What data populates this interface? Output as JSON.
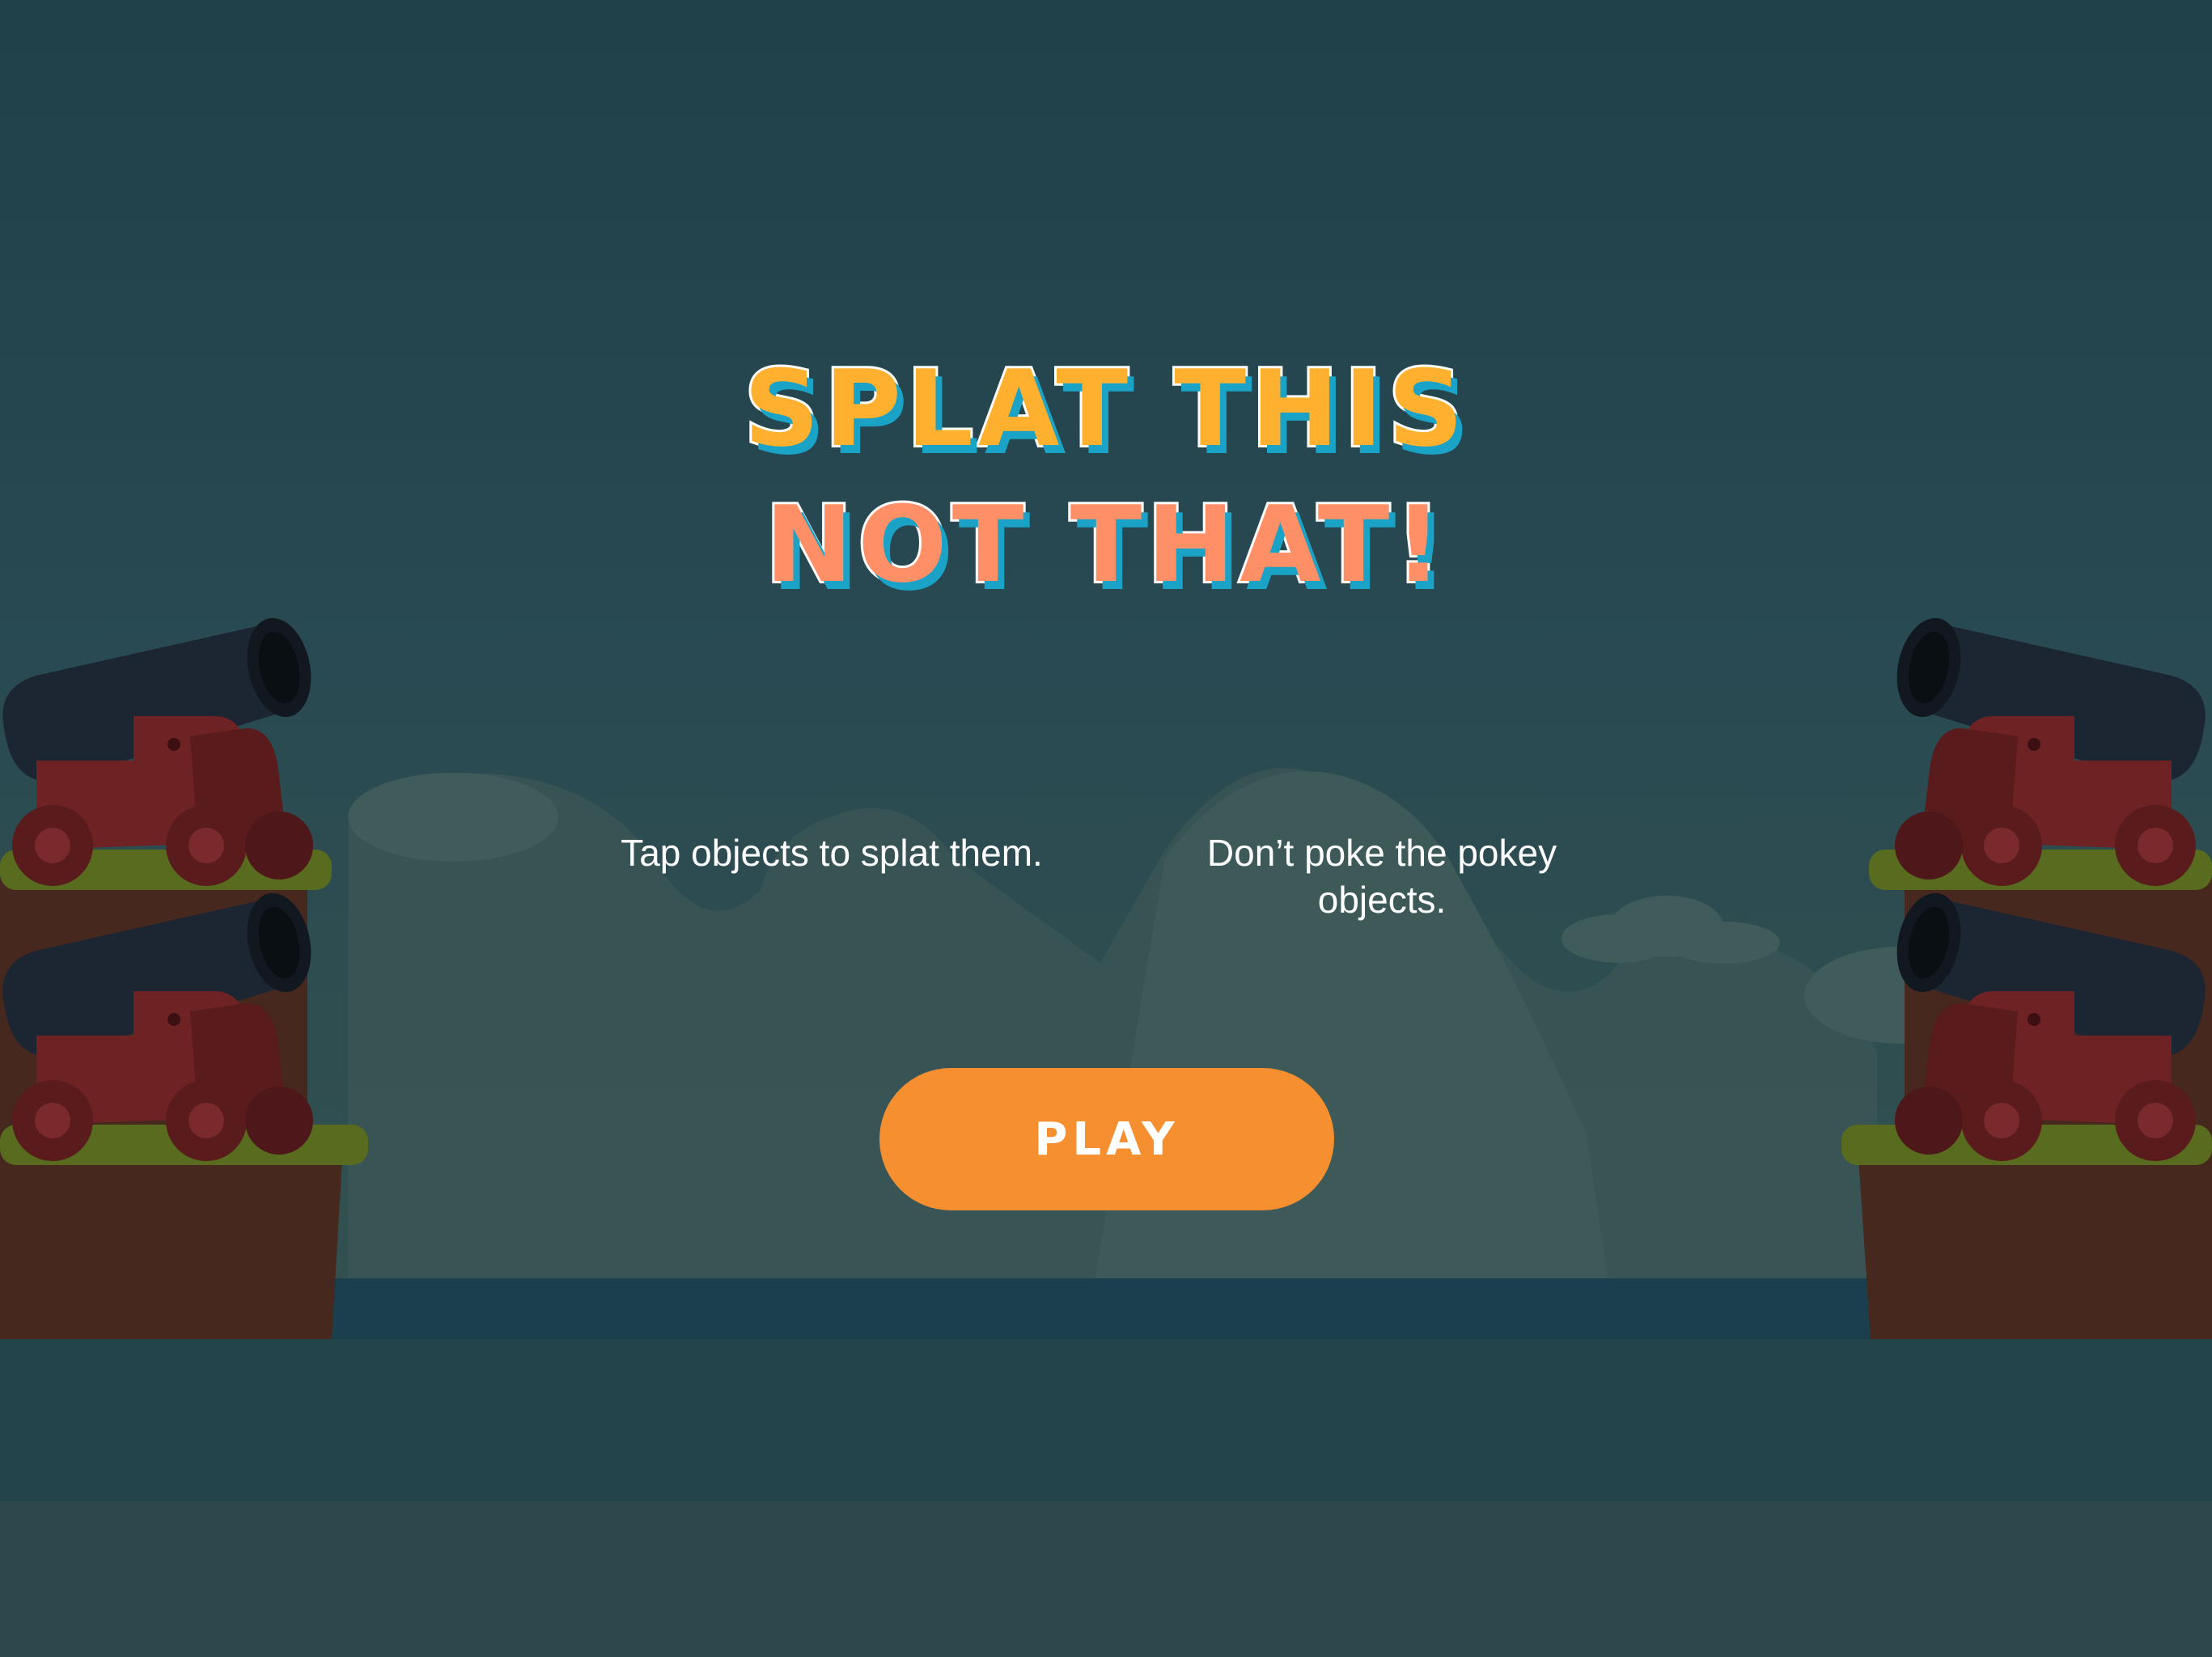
{
  "title": {
    "line1": "SPLAT THIS",
    "line2": "NOT THAT!"
  },
  "instructions": [
    "Tap objects to splat them.",
    "Don’t poke the pokey objects."
  ],
  "play_button": {
    "label": "PLAY"
  },
  "colors": {
    "background": "#264650",
    "title_line1": "#ffb02e",
    "title_line2": "#ff8f66",
    "title_shadow": "#1aa3c7",
    "play_button": "#f58f2f",
    "water": "#1b3f4d",
    "cannon_barrel": "#1c2632",
    "cannon_carriage": "#6e2224",
    "grass": "#586b1e",
    "cliff": "#46281e"
  }
}
